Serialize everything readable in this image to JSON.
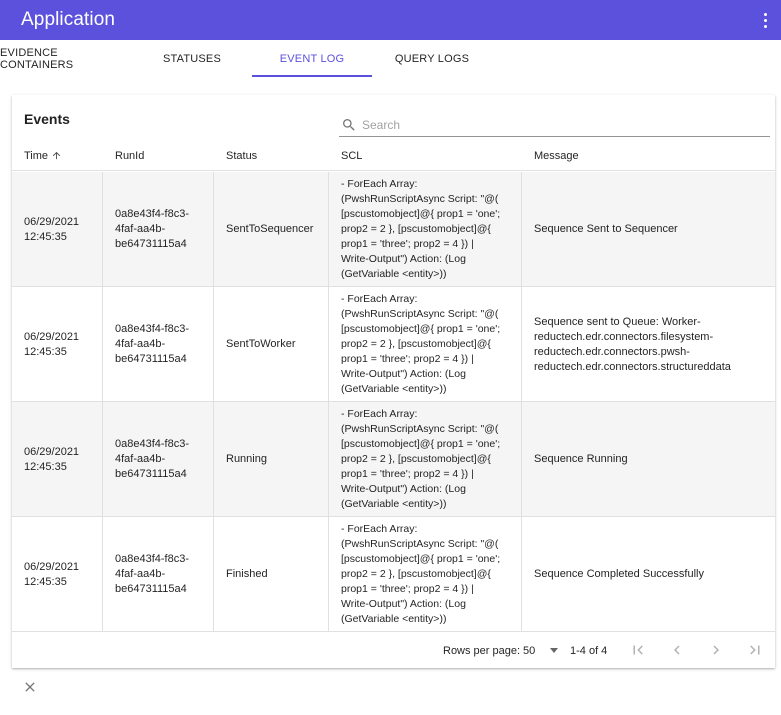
{
  "app": {
    "title": "Application",
    "menu_icon": "more-vert-icon"
  },
  "tabs": [
    {
      "label": "Evidence Containers",
      "active": false
    },
    {
      "label": "Statuses",
      "active": false
    },
    {
      "label": "Event Log",
      "active": true
    },
    {
      "label": "Query Logs",
      "active": false
    }
  ],
  "events": {
    "title": "Events",
    "search": {
      "placeholder": "Search",
      "value": "",
      "icon": "search-icon"
    },
    "columns": [
      {
        "label": "Time",
        "sorted": "ascending",
        "sort_icon": "arrow-up-icon"
      },
      {
        "label": "RunId"
      },
      {
        "label": "Status"
      },
      {
        "label": "SCL"
      },
      {
        "label": "Message"
      }
    ],
    "rows": [
      {
        "time": [
          "06/29/2021",
          "12:45:35"
        ],
        "run_id": [
          "0a8e43f4-f8c3-",
          "4faf-aa4b-",
          "be64731115a4"
        ],
        "status": "SentToSequencer",
        "scl": [
          "- ForEach Array:",
          "(PwshRunScriptAsync Script: \"@(",
          "[pscustomobject]@{ prop1 = 'one';",
          "prop2 = 2 }, [pscustomobject]@{",
          "prop1 = 'three'; prop2 = 4 }) |",
          "Write-Output\") Action: (Log",
          "(GetVariable <entity>))"
        ],
        "message": [
          "Sequence Sent to Sequencer"
        ]
      },
      {
        "time": [
          "06/29/2021",
          "12:45:35"
        ],
        "run_id": [
          "0a8e43f4-f8c3-",
          "4faf-aa4b-",
          "be64731115a4"
        ],
        "status": "SentToWorker",
        "scl": [
          "- ForEach Array:",
          "(PwshRunScriptAsync Script: \"@(",
          "[pscustomobject]@{ prop1 = 'one';",
          "prop2 = 2 }, [pscustomobject]@{",
          "prop1 = 'three'; prop2 = 4 }) |",
          "Write-Output\") Action: (Log",
          "(GetVariable <entity>))"
        ],
        "message": [
          "Sequence sent to Queue: Worker-",
          "reductech.edr.connectors.filesystem-",
          "reductech.edr.connectors.pwsh-",
          "reductech.edr.connectors.structureddata"
        ]
      },
      {
        "time": [
          "06/29/2021",
          "12:45:35"
        ],
        "run_id": [
          "0a8e43f4-f8c3-",
          "4faf-aa4b-",
          "be64731115a4"
        ],
        "status": "Running",
        "scl": [
          "- ForEach Array:",
          "(PwshRunScriptAsync Script: \"@(",
          "[pscustomobject]@{ prop1 = 'one';",
          "prop2 = 2 }, [pscustomobject]@{",
          "prop1 = 'three'; prop2 = 4 }) |",
          "Write-Output\") Action: (Log",
          "(GetVariable <entity>))"
        ],
        "message": [
          "Sequence Running"
        ]
      },
      {
        "time": [
          "06/29/2021",
          "12:45:35"
        ],
        "run_id": [
          "0a8e43f4-f8c3-",
          "4faf-aa4b-",
          "be64731115a4"
        ],
        "status": "Finished",
        "scl": [
          "- ForEach Array:",
          "(PwshRunScriptAsync Script: \"@(",
          "[pscustomobject]@{ prop1 = 'one';",
          "prop2 = 2 }, [pscustomobject]@{",
          "prop1 = 'three'; prop2 = 4 }) |",
          "Write-Output\") Action: (Log",
          "(GetVariable <entity>))"
        ],
        "message": [
          "Sequence Completed Successfully"
        ]
      }
    ],
    "pagination": {
      "rows_per_page_label": "Rows per page:",
      "rows_per_page": "50",
      "range": "1-4 of 4",
      "icons": [
        "first-page-icon",
        "previous-page-icon",
        "next-page-icon",
        "last-page-icon"
      ]
    }
  },
  "close": {
    "icon": "close-icon"
  },
  "colors": {
    "primary": "#5c51dc",
    "row_shade": "#f5f5f5",
    "divider": "#e0e0e0"
  }
}
